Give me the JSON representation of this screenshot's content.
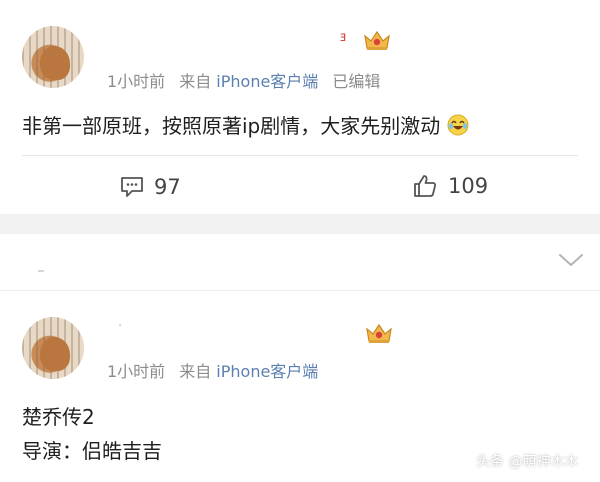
{
  "post1": {
    "meta": {
      "time": "1小时前",
      "from_label": "来自",
      "source": "iPhone客户端",
      "edited": "已编辑"
    },
    "text": "非第一部原班，按照原著ip剧情，大家先别激动",
    "emoji": "laughing-tears-emoji",
    "actions": {
      "comments": "97",
      "likes": "109"
    }
  },
  "post2": {
    "meta": {
      "time": "1小时前",
      "from_label": "来自",
      "source": "iPhone客户端"
    },
    "lines": [
      "楚乔传2",
      "导演：侣皓吉吉"
    ]
  },
  "icons": {
    "comment": "comment-icon",
    "like": "thumbs-up-icon",
    "badge": "crown-badge-icon",
    "expand": "chevron-down-icon"
  },
  "colors": {
    "source_link": "#5b7fb0",
    "meta_text": "#8c8c8c",
    "band": "#f2f2f2",
    "badge_gold": "#e0a23a"
  },
  "watermark": "头条 @萌神木木"
}
